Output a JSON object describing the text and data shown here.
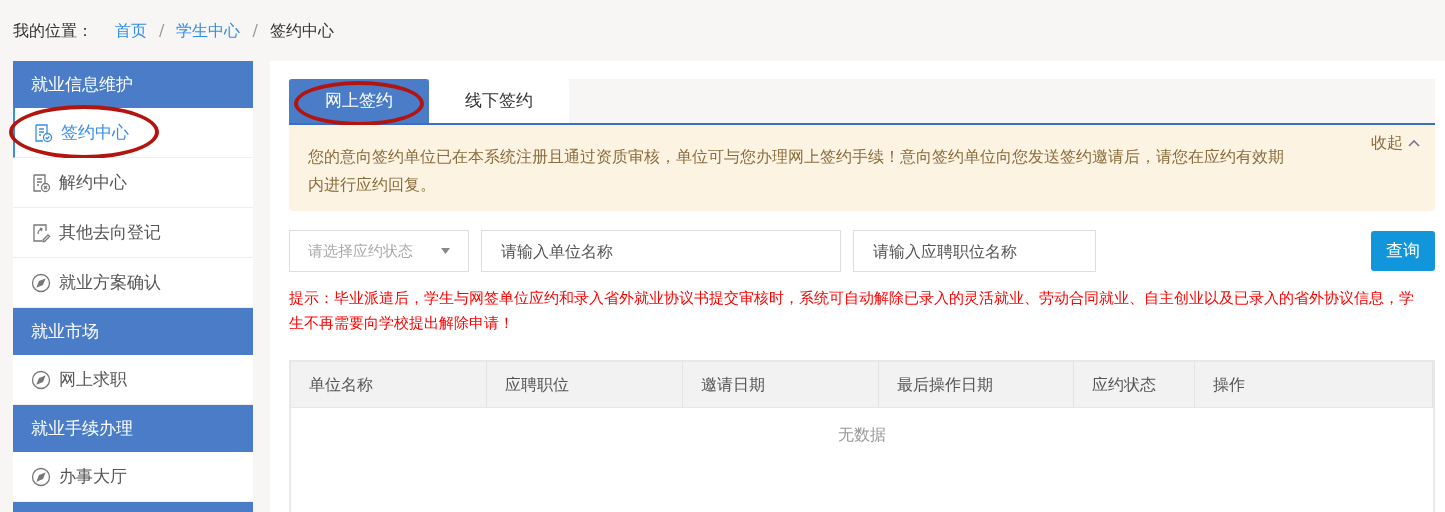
{
  "breadcrumb": {
    "label": "我的位置：",
    "items": [
      {
        "text": "首页",
        "current": false
      },
      {
        "text": "学生中心",
        "current": false
      },
      {
        "text": "签约中心",
        "current": true
      }
    ],
    "separator": "/"
  },
  "sidebar": {
    "groups": [
      {
        "title": "就业信息维护",
        "items": [
          {
            "label": "签约中心",
            "kind": "sign",
            "selected": true,
            "circled": true
          },
          {
            "label": "解约中心",
            "kind": "cancel",
            "selected": false,
            "circled": false
          },
          {
            "label": "其他去向登记",
            "kind": "edit",
            "selected": false,
            "circled": false
          },
          {
            "label": "就业方案确认",
            "kind": "compass",
            "selected": false,
            "circled": false
          }
        ]
      },
      {
        "title": "就业市场",
        "items": [
          {
            "label": "网上求职",
            "kind": "compass",
            "selected": false,
            "circled": false
          }
        ]
      },
      {
        "title": "就业手续办理",
        "items": [
          {
            "label": "办事大厅",
            "kind": "compass",
            "selected": false,
            "circled": false
          }
        ]
      }
    ]
  },
  "tabs": [
    {
      "label": "网上签约",
      "selected": true,
      "circled": true
    },
    {
      "label": "线下签约",
      "selected": false,
      "circled": false
    }
  ],
  "notice": {
    "text": "您的意向签约单位已在本系统注册且通过资质审核，单位可与您办理网上签约手续！意向签约单位向您发送签约邀请后，请您在应约有效期内进行应约回复。",
    "collapse": "收起"
  },
  "filters": {
    "status_select": {
      "placeholder": "请选择应约状态"
    },
    "unit_field": {
      "placeholder": "请输入单位名称"
    },
    "position_field": {
      "placeholder": "请输入应聘职位名称"
    },
    "query_button": "查询"
  },
  "hint": "提示：毕业派遣后，学生与网签单位应约和录入省外就业协议书提交审核时，系统可自动解除已录入的灵活就业、劳动合同就业、自主创业以及已录入的省外协议信息，学生不再需要向学校提出解除申请！",
  "table": {
    "columns": [
      "单位名称",
      "应聘职位",
      "邀请日期",
      "最后操作日期",
      "应约状态",
      "操作"
    ],
    "empty_text": "无数据"
  }
}
